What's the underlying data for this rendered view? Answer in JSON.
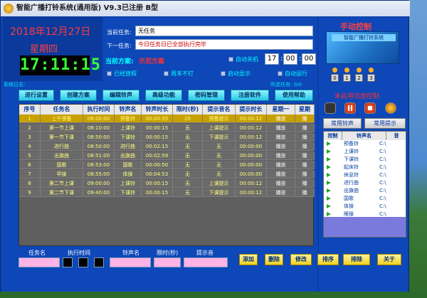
{
  "window": {
    "title": "智能广播打铃系统(通用版) V9.3已注册 B型"
  },
  "clock": {
    "date": "2018年12月27日",
    "weekday": "星期四",
    "time": "17:11:15"
  },
  "task": {
    "current_label": "当前任务:",
    "current_value": "无任务",
    "next_label": "下一任务:",
    "next_value": "今日任务日已全部执行完毕"
  },
  "plan": {
    "label": "当前方案:",
    "value": "示范方案"
  },
  "options": {
    "auto_shutdown": "自动关机",
    "holiday": "已经放假",
    "weekend": "周末不打",
    "autostart": "启动显示",
    "autorun": "自动运行",
    "shutdown_h": "17",
    "shutdown_m": "00",
    "shutdown_s": "00"
  },
  "log": {
    "label": "系统日志:",
    "selected": "所选任务: 0/0"
  },
  "toolbar": [
    "进行设置",
    "创建方案",
    "编辑铃声",
    "高级功能",
    "密码管理",
    "注册软件",
    "使用帮助"
  ],
  "grid": {
    "headers": [
      "序号",
      "任务名",
      "执行时间",
      "铃声名",
      "铃声时长",
      "限时(秒)",
      "提示音名",
      "提示时长",
      "星期一",
      "星期"
    ],
    "rows": [
      [
        "1",
        "上午预备",
        "08:00:00",
        "预备铃",
        "00:00:35",
        "20",
        "预备提示",
        "00:00:12",
        "播放",
        "播"
      ],
      [
        "2",
        "第一节上课",
        "08:10:00",
        "上课铃",
        "00:00:15",
        "无",
        "上课提示",
        "00:00:12",
        "播放",
        "播"
      ],
      [
        "3",
        "第一节下课",
        "08:50:00",
        "下课铃",
        "00:00:15",
        "无",
        "下课提示",
        "00:00:12",
        "播放",
        "播"
      ],
      [
        "4",
        "进行曲",
        "08:50:00",
        "进行曲",
        "00:02:15",
        "无",
        "无",
        "00:00:00",
        "播放",
        "播"
      ],
      [
        "5",
        "出旗曲",
        "08:51:00",
        "出旗曲",
        "00:02:59",
        "无",
        "无",
        "00:00:00",
        "播放",
        "播"
      ],
      [
        "6",
        "国歌",
        "08:53:00",
        "国歌",
        "00:00:50",
        "无",
        "无",
        "00:00:00",
        "播放",
        "播"
      ],
      [
        "7",
        "早操",
        "08:55:00",
        "体操",
        "00:04:53",
        "无",
        "无",
        "00:00:00",
        "播放",
        "播"
      ],
      [
        "8",
        "第二节上课",
        "09:00:00",
        "上课铃",
        "00:00:15",
        "无",
        "上课提示",
        "00:00:12",
        "播放",
        "播"
      ],
      [
        "9",
        "第二节下课",
        "09:40:00",
        "下课铃",
        "00:00:15",
        "无",
        "下课提示",
        "00:00:12",
        "播放",
        "播"
      ]
    ]
  },
  "right": {
    "title": "手动控制",
    "banner": "智能广播打铃系统",
    "indicator_labels": [
      "0",
      "1",
      "2",
      "3"
    ],
    "amp": "未启用功放控制",
    "common_ring": "常用铃声",
    "common_tip": "常用提示",
    "rgrid_headers": [
      "控制",
      "铃声名",
      "音"
    ],
    "rgrid_rows": [
      [
        "预备铃",
        "C:\\"
      ],
      [
        "上课铃",
        "C:\\"
      ],
      [
        "下课铃",
        "C:\\"
      ],
      [
        "起床铃",
        "C:\\"
      ],
      [
        "休息铃",
        "C:\\"
      ],
      [
        "进行曲",
        "C:\\"
      ],
      [
        "出旗曲",
        "C:\\"
      ],
      [
        "国歌",
        "C:\\"
      ],
      [
        "体操",
        "C:\\"
      ],
      [
        "眼操",
        "C:\\"
      ]
    ]
  },
  "bottom": {
    "labels": [
      "任务名",
      "执行时间",
      "铃声名",
      "限时(秒)",
      "提示音"
    ],
    "buttons": [
      "添加",
      "删除",
      "修改",
      "排序",
      "排除",
      "关于"
    ]
  },
  "colors": {
    "window_bg": "#0e3ea0",
    "accent_red": "#ff3b3b",
    "digital_green": "#39ff39"
  }
}
